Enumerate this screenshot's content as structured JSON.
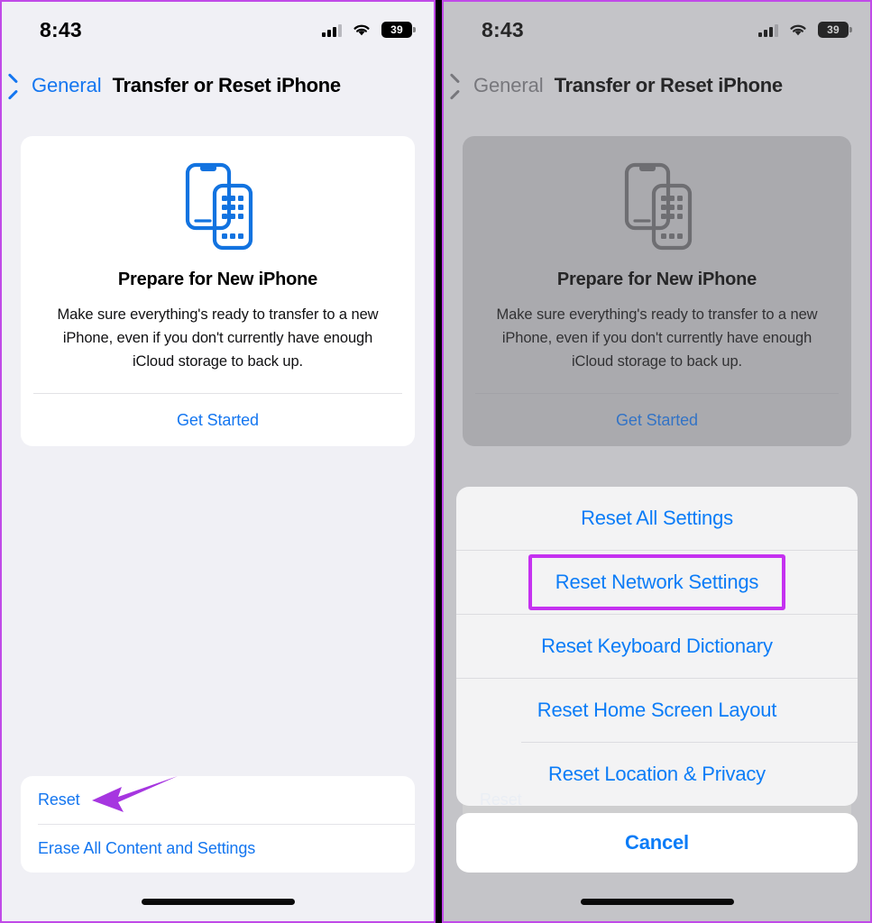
{
  "status_bar": {
    "time": "8:43",
    "battery_level": "39",
    "signal_icon": "cellular-signal-icon",
    "wifi_icon": "wifi-icon",
    "battery_icon": "battery-icon"
  },
  "nav": {
    "back_label": "General",
    "back_icon": "chevron-left-icon",
    "title": "Transfer or Reset iPhone"
  },
  "prepare_card": {
    "icon": "two-iphones-icon",
    "title": "Prepare for New iPhone",
    "description": "Make sure everything's ready to transfer to a new iPhone, even if you don't currently have enough iCloud storage to back up.",
    "action_label": "Get Started"
  },
  "reset_group": {
    "items": [
      {
        "label": "Reset"
      },
      {
        "label": "Erase All Content and Settings"
      }
    ]
  },
  "action_sheet": {
    "items": [
      {
        "label": "Reset All Settings",
        "highlighted": false
      },
      {
        "label": "Reset Network Settings",
        "highlighted": true
      },
      {
        "label": "Reset Keyboard Dictionary",
        "highlighted": false
      },
      {
        "label": "Reset Home Screen Layout",
        "highlighted": false
      },
      {
        "label": "Reset Location & Privacy",
        "highlighted": false
      }
    ],
    "cancel_label": "Cancel"
  },
  "annotations": {
    "arrow_color": "#a636e0",
    "highlight_color": "#c531f0",
    "arrow_target": "Reset",
    "highlight_target": "Reset Network Settings"
  },
  "colors": {
    "accent_blue": "#1476f0",
    "sheet_blue": "#0b7cf7",
    "panel_background": "#f0f0f5",
    "card_background": "#ffffff",
    "panel_border": "#c04ae8",
    "dim_overlay": "rgba(110,110,115,0.34)"
  }
}
